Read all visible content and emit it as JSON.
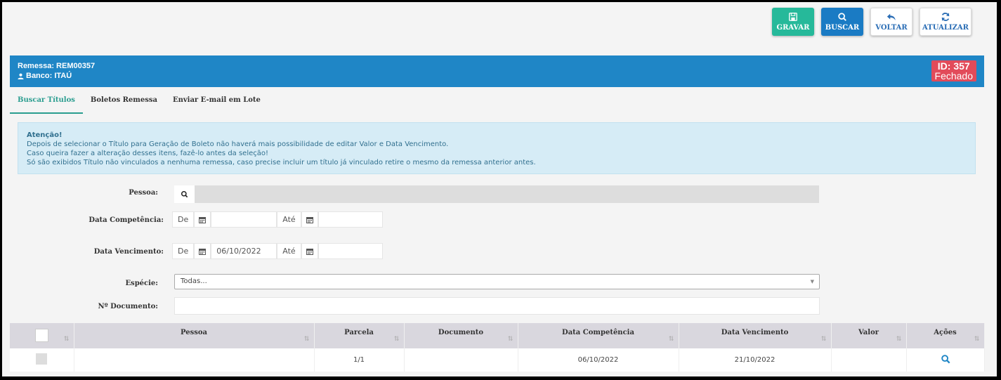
{
  "toolbar": {
    "save_label": "GRAVAR",
    "search_label": "BUSCAR",
    "back_label": "VOLTAR",
    "refresh_label": "ATUALIZAR"
  },
  "header": {
    "remessa": "Remessa: REM00357",
    "banco": "Banco: ITAÚ",
    "id": "ID: 357",
    "status": "Fechado"
  },
  "tabs": [
    {
      "label": "Buscar Títulos",
      "active": true
    },
    {
      "label": "Boletos Remessa",
      "active": false
    },
    {
      "label": "Enviar E-mail em Lote",
      "active": false
    }
  ],
  "alert": {
    "title": "Atenção!",
    "lines": [
      "Depois de selecionar o Título para Geração de Boleto não haverá mais possibilidade de editar Valor e Data Vencimento.",
      "Caso queira fazer a alteração desses itens, fazê-lo antes da seleção!",
      "Só são exibidos Título não vinculados a nenhuma remessa, caso precise incluir um título já vinculado retire o mesmo da remessa anterior antes."
    ]
  },
  "form": {
    "pessoa_label": "Pessoa:",
    "competencia_label": "Data Competência:",
    "vencimento_label": "Data Vencimento:",
    "de": "De",
    "ate": "Até",
    "competencia_de": "",
    "competencia_ate": "",
    "vencimento_de": "06/10/2022",
    "vencimento_ate": "",
    "especie_label": "Espécie:",
    "especie_value": "Todas...",
    "documento_label": "Nº Documento:",
    "documento_value": ""
  },
  "table": {
    "headers": [
      "Pessoa",
      "Parcela",
      "Documento",
      "Data Competência",
      "Data Vencimento",
      "Valor",
      "Ações"
    ],
    "rows": [
      {
        "pessoa": "",
        "parcela": "1/1",
        "documento": "",
        "competencia": "06/10/2022",
        "vencimento": "21/10/2022",
        "valor": ""
      }
    ]
  },
  "colors": {
    "header_bg": "#1f86c6",
    "badge": "#e24b5a",
    "save": "#26b99a",
    "search": "#1a7bc4",
    "tab_active": "#2a9d8f"
  }
}
